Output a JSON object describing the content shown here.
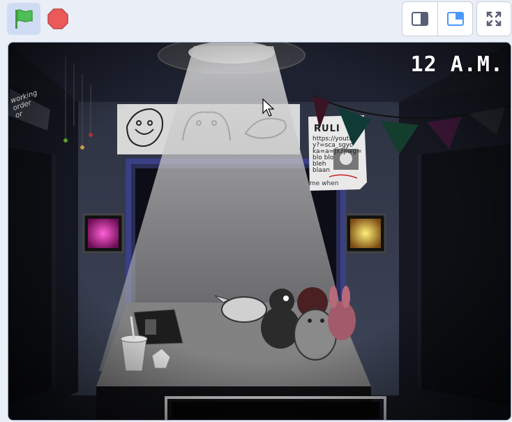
{
  "toolbar": {
    "green_flag": "green-flag-icon",
    "stop": "stop-sign-icon",
    "small_stage": "small-stage-icon",
    "normal_stage": "normal-stage-icon",
    "fullscreen": "fullscreen-icon"
  },
  "game": {
    "time": "12 A.M.",
    "poster": {
      "title": "RULI",
      "lines": [
        "https://youtu",
        "y?=sca_sgyc",
        "ka=a=Jx7Jiwg=",
        "blo blo",
        "bleh",
        "blaan"
      ],
      "caption": "me when"
    },
    "sign_lines": [
      "working",
      "order",
      "or"
    ]
  },
  "colors": {
    "flag_green": "#4cbf56",
    "stop_red": "#ec5959",
    "accent_blue": "#4c97ff"
  }
}
